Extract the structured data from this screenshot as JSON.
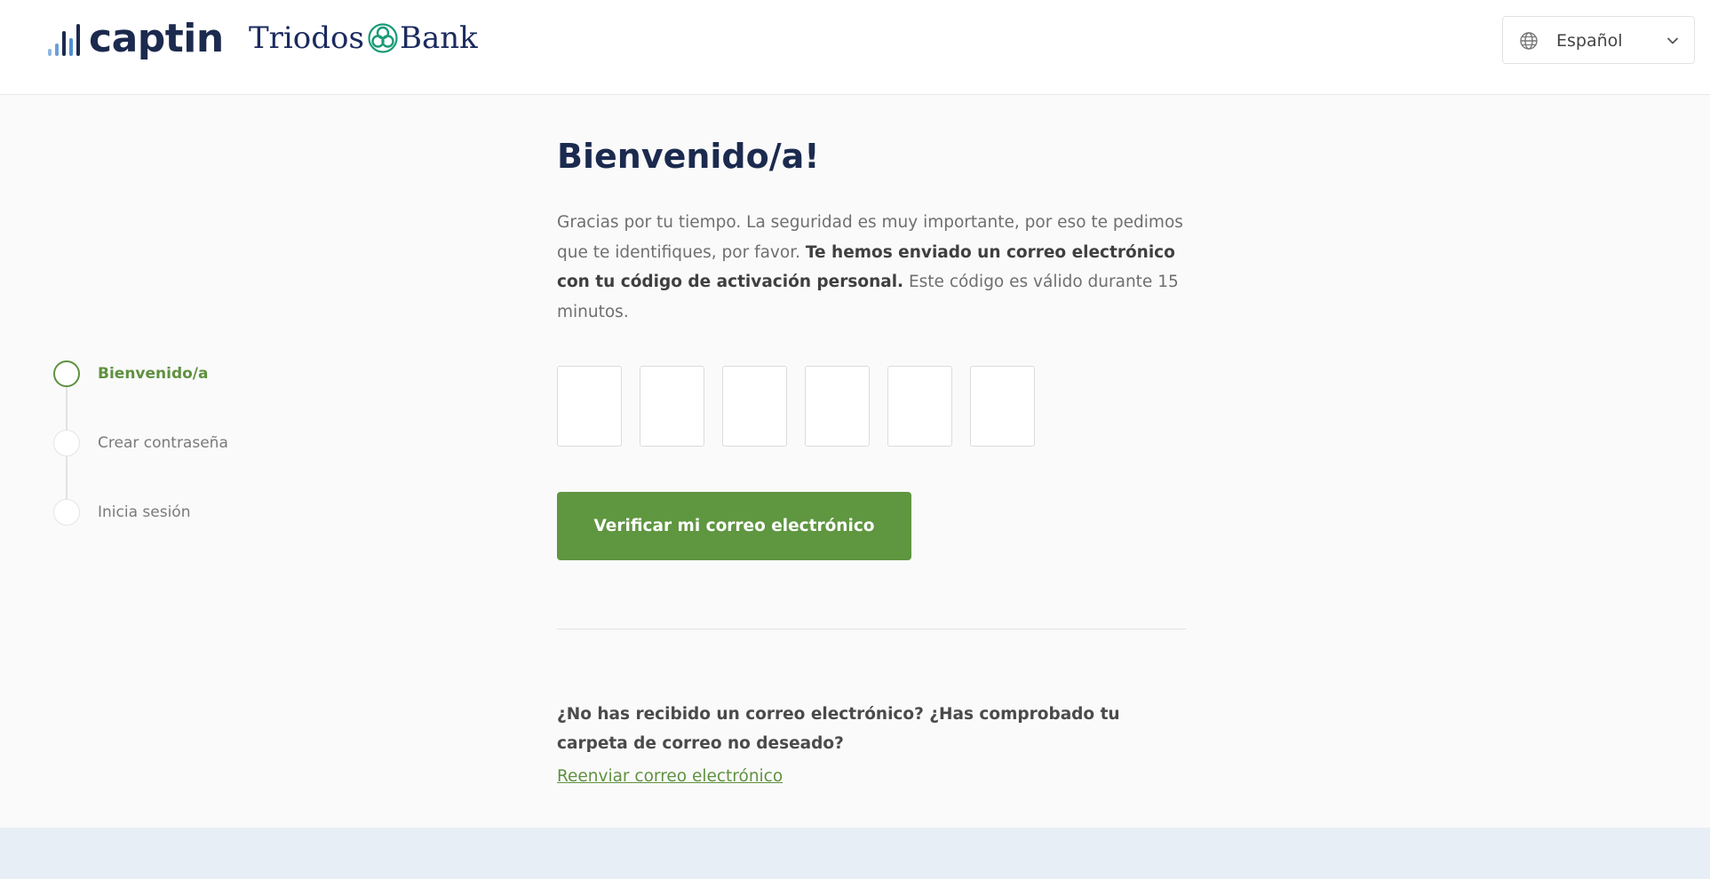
{
  "header": {
    "logo_captin": "captin",
    "logo_triodos_left": "Triodos",
    "logo_triodos_right": "Bank",
    "language": {
      "selected": "Español",
      "icon": "globe-icon",
      "dropdown_icon": "chevron-down-icon"
    }
  },
  "stepper": {
    "steps": [
      {
        "label": "Bienvenido/a",
        "active": true
      },
      {
        "label": "Crear contraseña",
        "active": false
      },
      {
        "label": "Inicia sesión",
        "active": false
      }
    ]
  },
  "main": {
    "title": "Bienvenido/a!",
    "intro_part1": "Gracias por tu tiempo. La seguridad es muy importante, por eso te pedimos que te identifiques, por favor. ",
    "intro_bold": "Te hemos enviado un correo electrónico con tu código de activación personal.",
    "intro_part2": " Este código es válido durante 15 minutos.",
    "code_digits": [
      "",
      "",
      "",
      "",
      "",
      ""
    ],
    "verify_button": "Verificar mi correo electrónico",
    "question": "¿No has recibido un correo electrónico? ¿Has comprobado tu carpeta de correo no deseado?",
    "resend_link": "Reenviar correo electrónico"
  },
  "colors": {
    "brand_navy": "#1b2a4e",
    "accent_green": "#5f9640",
    "footer_band": "#e7eef6"
  }
}
